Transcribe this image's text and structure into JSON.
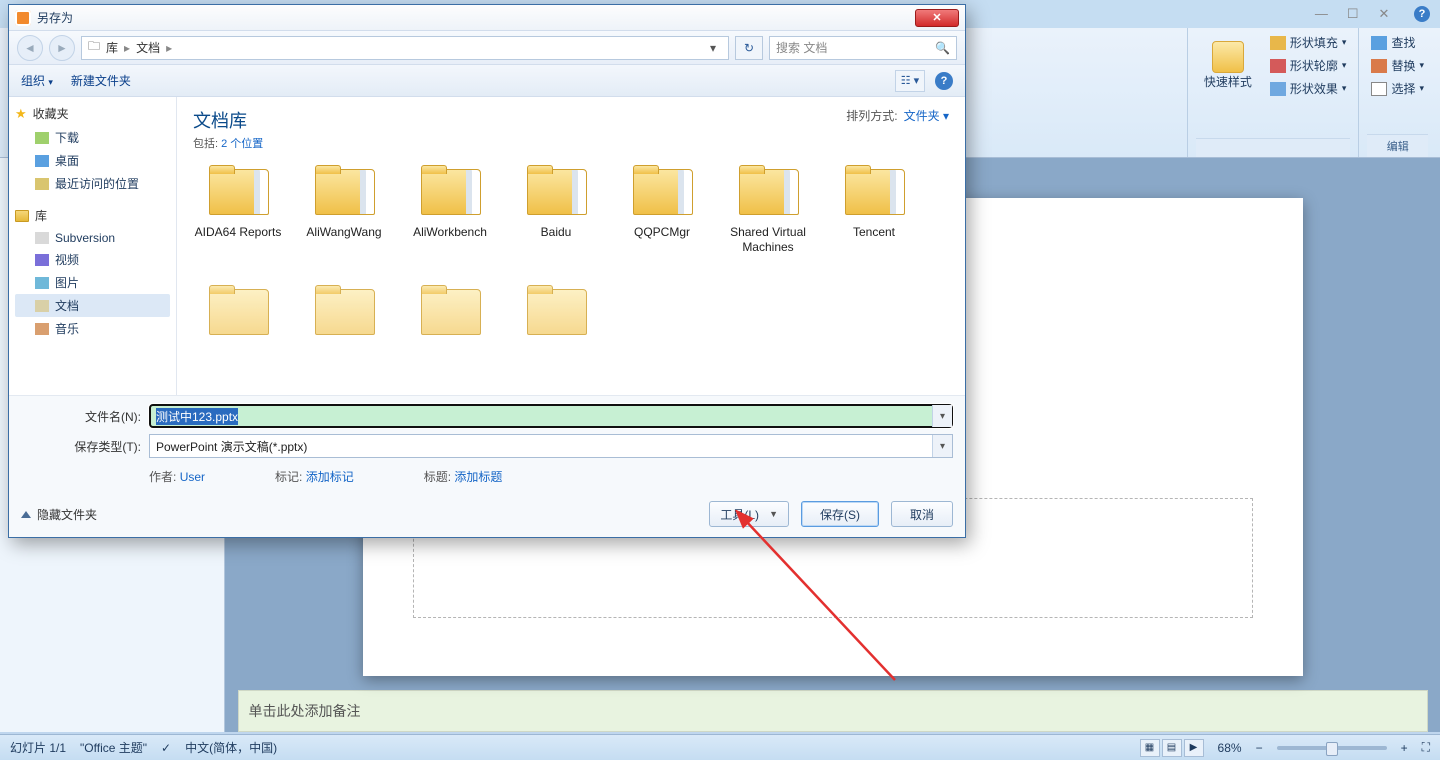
{
  "ppt": {
    "ribbon": {
      "quickstyle": "快速样式",
      "shape_fill": "形状填充",
      "shape_outline": "形状轮廓",
      "shape_effects": "形状效果",
      "find": "查找",
      "replace": "替换",
      "select": "选择",
      "group_draw": "",
      "group_edit": "编辑"
    },
    "slide": {
      "notes_placeholder": "单击此处添加备注"
    },
    "status": {
      "slide_no": "幻灯片 1/1",
      "theme": "\"Office 主题\"",
      "lang": "中文(简体，中国)",
      "zoom": "68%"
    }
  },
  "dialog": {
    "title": "另存为",
    "nav": {
      "library": "库",
      "docs": "文档"
    },
    "search_placeholder": "搜索 文档",
    "toolbar": {
      "organize": "组织",
      "new_folder": "新建文件夹"
    },
    "tree": {
      "favorites": "收藏夹",
      "downloads": "下载",
      "desktop": "桌面",
      "recent": "最近访问的位置",
      "libraries": "库",
      "subversion": "Subversion",
      "videos": "视频",
      "pictures": "图片",
      "documents": "文档",
      "music": "音乐"
    },
    "content": {
      "lib_title": "文档库",
      "lib_sub_prefix": "包括: ",
      "lib_sub_link": "2 个位置",
      "sort_label": "排列方式:",
      "sort_value": "文件夹",
      "folders": [
        "AIDA64 Reports",
        "AliWangWang",
        "AliWorkbench",
        "Baidu",
        "QQPCMgr",
        "Shared Virtual Machines",
        "Tencent",
        "",
        "",
        "",
        ""
      ]
    },
    "foot": {
      "filename_label": "文件名(N):",
      "filename_value": "测试中123.pptx",
      "filetype_label": "保存类型(T):",
      "filetype_value": "PowerPoint 演示文稿(*.pptx)",
      "author_label": "作者:",
      "author_value": "User",
      "tag_label": "标记:",
      "tag_value": "添加标记",
      "title_label": "标题:",
      "title_value": "添加标题",
      "hide_folders": "隐藏文件夹",
      "tools": "工具(L)",
      "save": "保存(S)",
      "cancel": "取消"
    }
  }
}
